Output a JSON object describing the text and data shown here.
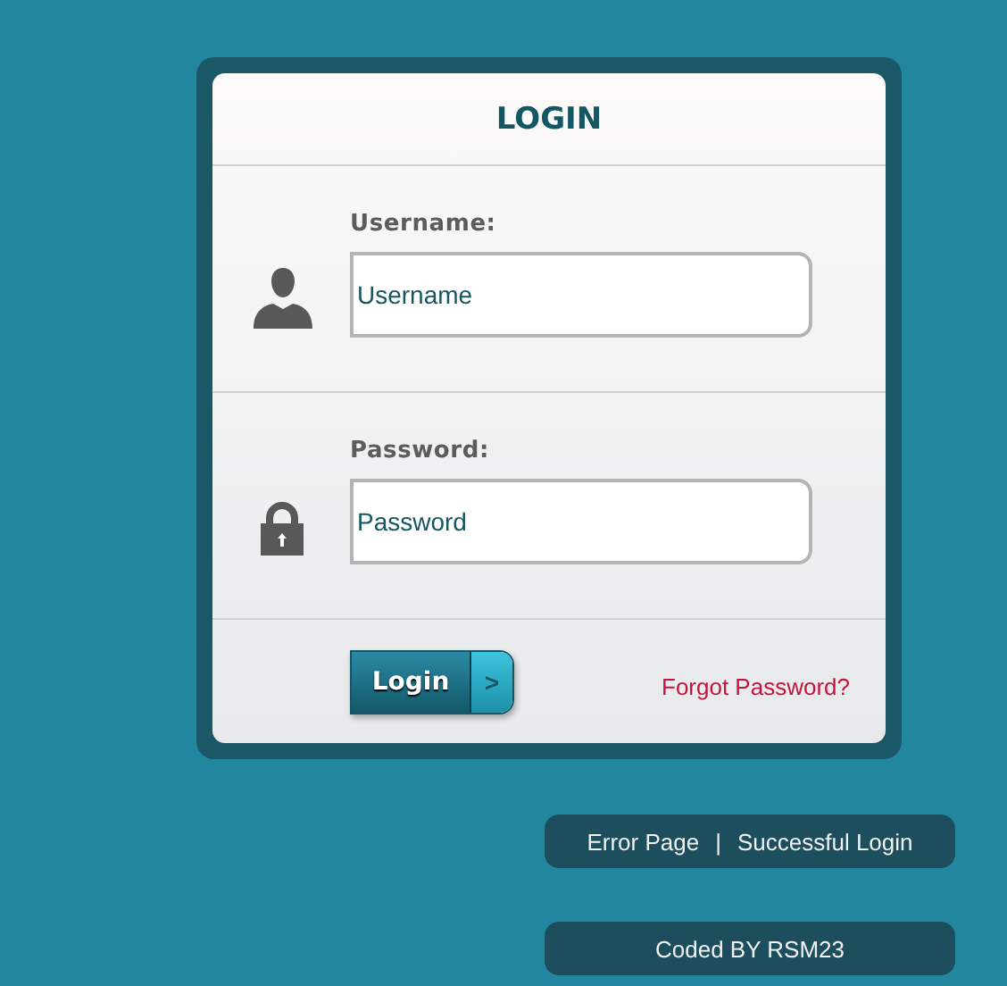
{
  "login_form": {
    "title": "LOGIN",
    "fields": [
      {
        "kind": "user",
        "label": "Username:",
        "value": "Username"
      },
      {
        "kind": "lock",
        "label": "Password:",
        "value": "Password"
      }
    ],
    "submit_button": {
      "label": "Login",
      "arrow": ">"
    },
    "forgot_link": "Forgot Password?"
  },
  "links_bar": {
    "links": [
      "Error Page",
      "Successful Login"
    ],
    "separator": "|"
  },
  "credit": "Coded BY RSM23"
}
